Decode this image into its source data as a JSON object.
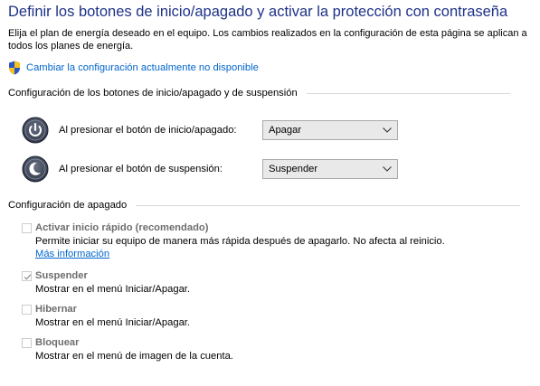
{
  "header": {
    "title": "Definir los botones de inicio/apagado y activar la protección con contraseña",
    "description": "Elija el plan de energía deseado en el equipo. Los cambios realizados en la configuración de esta página se aplican a todos los planes de energía.",
    "change_settings_link": "Cambiar la configuración actualmente no disponible"
  },
  "power_buttons": {
    "section_title": "Configuración de los botones de inicio/apagado y de suspensión",
    "rows": [
      {
        "label": "Al presionar el botón de inicio/apagado:",
        "value": "Apagar",
        "icon": "power-icon"
      },
      {
        "label": "Al presionar el botón de suspensión:",
        "value": "Suspender",
        "icon": "sleep-moon-icon"
      }
    ]
  },
  "shutdown": {
    "section_title": "Configuración de apagado",
    "options": [
      {
        "name": "Activar inicio rápido (recomendado)",
        "checked": false,
        "description": "Permite iniciar su equipo de manera más rápida después de apagarlo. No afecta al reinicio.",
        "more_link": "Más información"
      },
      {
        "name": "Suspender",
        "checked": true,
        "description": "Mostrar en el menú Iniciar/Apagar."
      },
      {
        "name": "Hibernar",
        "checked": false,
        "description": "Mostrar en el menú Iniciar/Apagar."
      },
      {
        "name": "Bloquear",
        "checked": false,
        "description": "Mostrar en el menú de imagen de la cuenta."
      }
    ]
  },
  "colors": {
    "title": "#1e3287",
    "link": "#0066cc",
    "disabled_text": "#6d6d6d"
  }
}
